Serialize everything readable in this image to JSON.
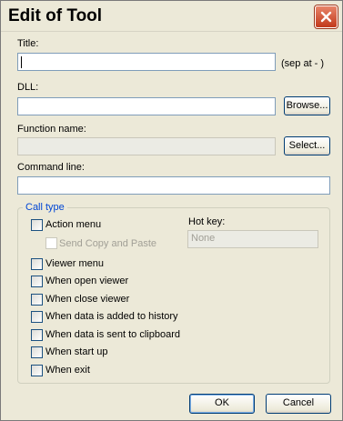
{
  "window": {
    "title": "Edit of Tool"
  },
  "title_field": {
    "label": "Title:",
    "value": "",
    "hint": "(sep at - )"
  },
  "dll_field": {
    "label": "DLL:",
    "value": "",
    "browse_label": "Browse..."
  },
  "function_field": {
    "label": "Function name:",
    "value": "",
    "select_label": "Select..."
  },
  "command_field": {
    "label": "Command line:",
    "value": ""
  },
  "call_type": {
    "legend": "Call type",
    "action_menu": "Action menu",
    "send_copy_paste": "Send Copy and Paste",
    "viewer_menu": "Viewer menu",
    "when_open_viewer": "When open viewer",
    "when_close_viewer": "When close viewer",
    "when_history": "When data is added to history",
    "when_clipboard": "When data is sent to clipboard",
    "when_start_up": "When start up",
    "when_exit": "When exit"
  },
  "hotkey": {
    "label": "Hot key:",
    "value": "None"
  },
  "buttons": {
    "ok": "OK",
    "cancel": "Cancel"
  },
  "colors": {
    "accent": "#0046d5",
    "close": "#c2391b",
    "face": "#ece9d8"
  }
}
